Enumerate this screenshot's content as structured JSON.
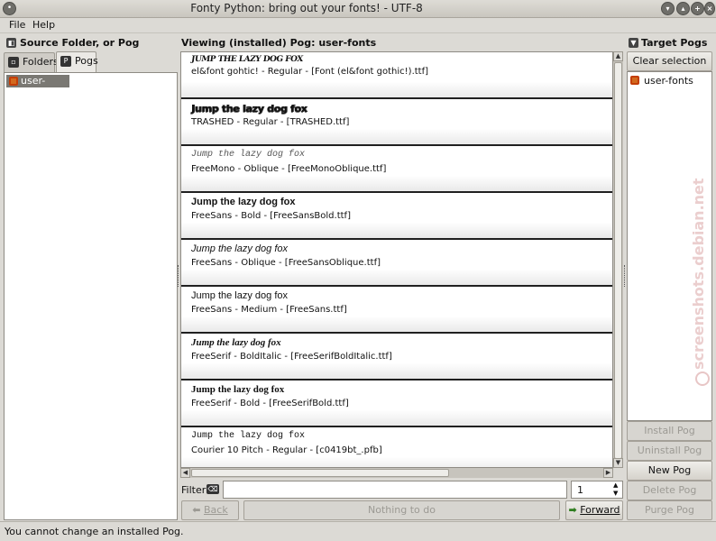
{
  "window": {
    "title": "Fonty Python: bring out your fonts!   -   UTF-8"
  },
  "menu": {
    "file": "File",
    "help": "Help"
  },
  "left_panel": {
    "header": "Source Folder, or Pog",
    "tabs": [
      {
        "label": "Folders"
      },
      {
        "label": "Pogs"
      }
    ],
    "pogs": [
      {
        "label": "user-fonts"
      }
    ]
  },
  "center": {
    "header": "Viewing (installed) Pog: user-fonts",
    "fonts": [
      {
        "sample": "JUMP THE LAZY DOG FOX",
        "info": "el&font gohtic! - Regular - [Font (el&font gothic!).ttf]"
      },
      {
        "sample": "Jump the lazy dog fox",
        "info": "TRASHED - Regular - [TRASHED.ttf]"
      },
      {
        "sample": "Jump the lazy dog fox",
        "info": "FreeMono - Oblique - [FreeMonoOblique.ttf]"
      },
      {
        "sample": "Jump the lazy dog fox",
        "info": "FreeSans - Bold - [FreeSansBold.ttf]"
      },
      {
        "sample": "Jump the lazy dog fox",
        "info": "FreeSans - Oblique - [FreeSansOblique.ttf]"
      },
      {
        "sample": "Jump the lazy dog fox",
        "info": "FreeSans - Medium - [FreeSans.ttf]"
      },
      {
        "sample": "Jump the lazy dog fox",
        "info": "FreeSerif - BoldItalic - [FreeSerifBoldItalic.ttf]"
      },
      {
        "sample": "Jump the lazy dog fox",
        "info": "FreeSerif - Bold - [FreeSerifBold.ttf]"
      },
      {
        "sample": "Jump the lazy dog fox",
        "info": "Courier 10 Pitch - Regular - [c0419bt_.pfb]"
      }
    ],
    "filter_label": "Filter:",
    "filter_value": "",
    "page_number": "1",
    "back_label": "Back",
    "status_button": "Nothing to do",
    "forward_label": "Forward"
  },
  "right_panel": {
    "header": "Target Pogs",
    "clear_selection": "Clear selection",
    "pogs": [
      {
        "label": "user-fonts"
      }
    ],
    "install": "Install Pog",
    "uninstall": "Uninstall Pog",
    "new": "New Pog",
    "delete": "Delete Pog",
    "purge": "Purge Pog"
  },
  "status": {
    "text": "You cannot change an installed Pog."
  },
  "watermark": "screenshots.debian.net"
}
